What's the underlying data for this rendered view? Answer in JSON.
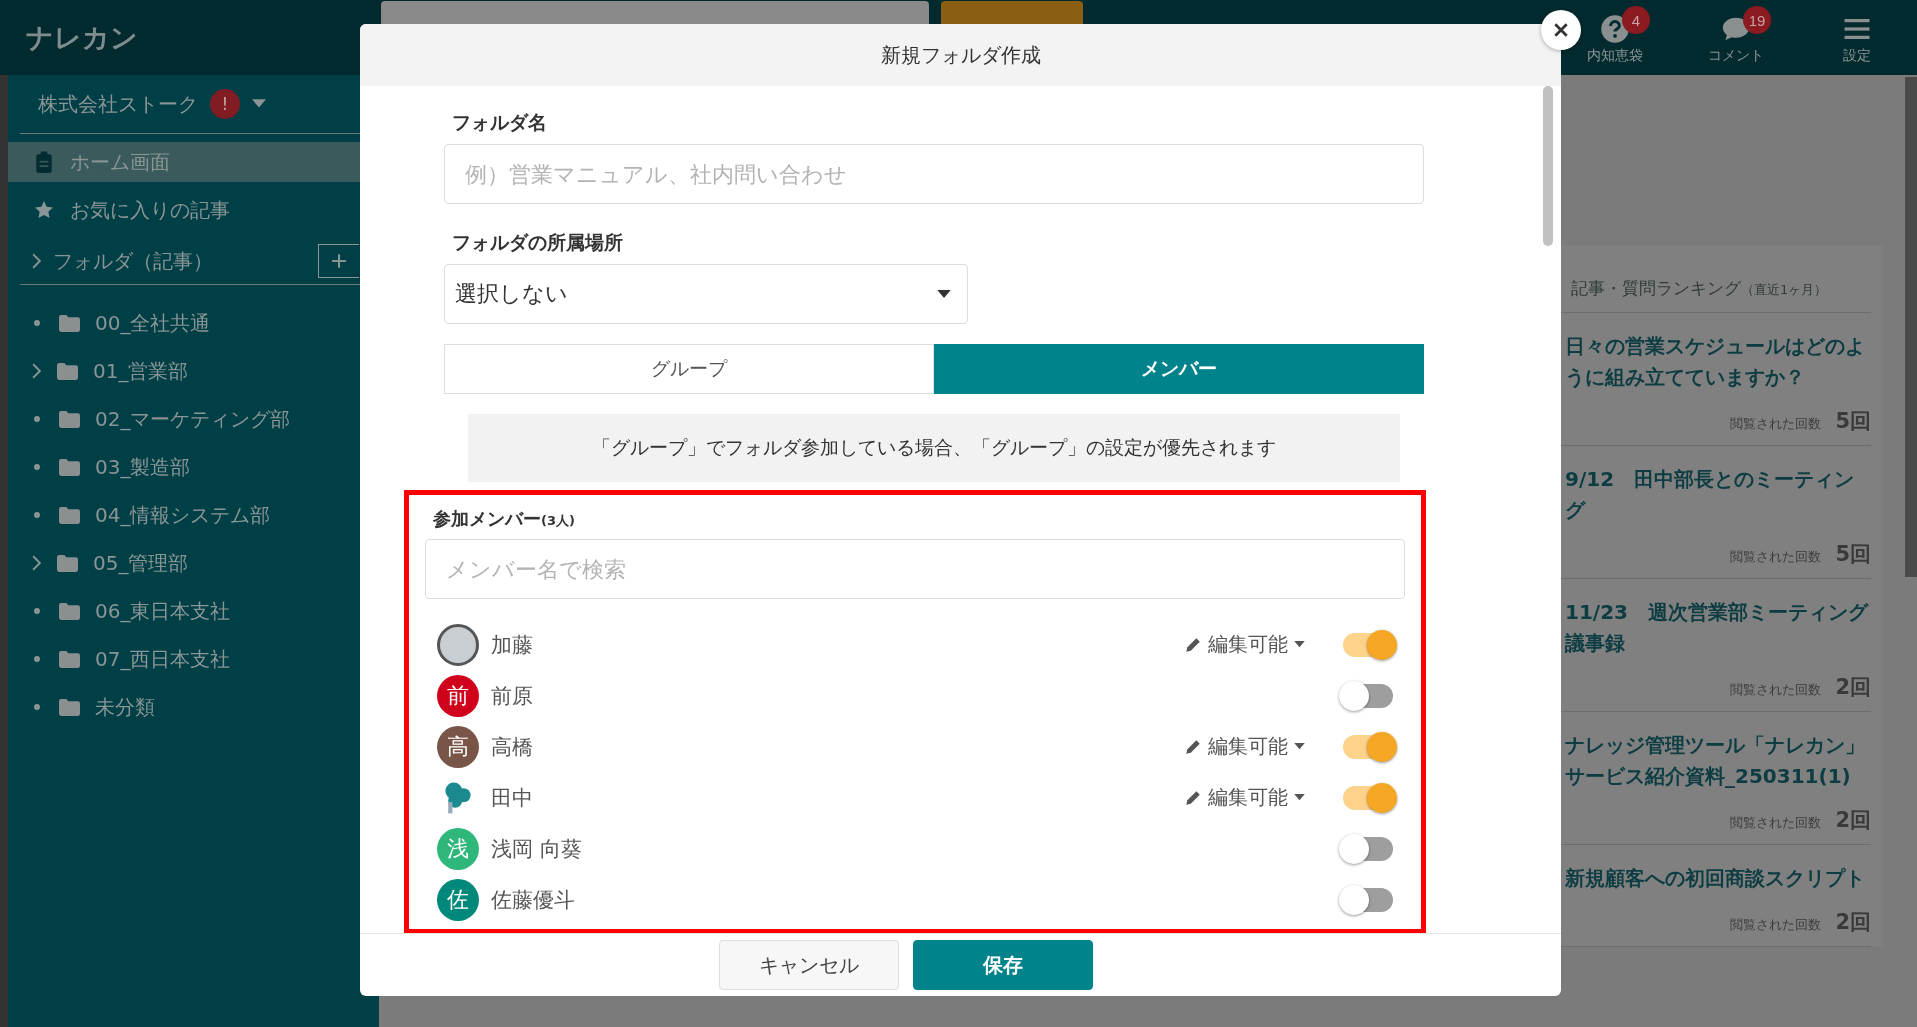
{
  "header": {
    "logo": "ナレカン",
    "icons": [
      {
        "kind": "help",
        "label": "内知恵袋",
        "badge": "4"
      },
      {
        "kind": "comment",
        "label": "コメント",
        "badge": "19"
      },
      {
        "kind": "menu",
        "label": "設定"
      }
    ]
  },
  "sidebar": {
    "company": "株式会社ストーク",
    "company_alert": "!",
    "nav": [
      {
        "kind": "home",
        "label": "ホーム画面",
        "selected": true
      },
      {
        "kind": "star",
        "label": "お気に入りの記事",
        "selected": false
      }
    ],
    "folder_section": {
      "label": "フォルダ（記事）"
    },
    "folders": [
      {
        "label": "00_全社共通",
        "expandable": false
      },
      {
        "label": "01_営業部",
        "expandable": true
      },
      {
        "label": "02_マーケティング部",
        "expandable": false
      },
      {
        "label": "03_製造部",
        "expandable": false
      },
      {
        "label": "04_情報システム部",
        "expandable": false
      },
      {
        "label": "05_管理部",
        "expandable": true
      },
      {
        "label": "06_東日本支社",
        "expandable": false
      },
      {
        "label": "07_西日本支社",
        "expandable": false
      },
      {
        "label": "未分類",
        "expandable": false
      }
    ]
  },
  "ranking": {
    "title": "記事・質問ランキング",
    "period": "（直近1ヶ月）",
    "items": [
      {
        "title": "日々の営業スケジュールはどのように組み立てていますか？",
        "views_label": "閲覧された回数",
        "views": "5回"
      },
      {
        "title": "9/12　田中部長とのミーティング",
        "views_label": "閲覧された回数",
        "views": "5回"
      },
      {
        "title": "11/23　週次営業部ミーティング議事録",
        "views_label": "閲覧された回数",
        "views": "2回"
      },
      {
        "title": "ナレッジ管理ツール「ナレカン」サービス紹介資料_250311(1)",
        "views_label": "閲覧された回数",
        "views": "2回"
      },
      {
        "title": "新規顧客への初回商談スクリプト",
        "views_label": "閲覧された回数",
        "views": "2回"
      }
    ]
  },
  "dialog": {
    "title": "新規フォルダ作成",
    "name_field": {
      "label": "フォルダ名",
      "placeholder": "例）営業マニュアル、社内問い合わせ"
    },
    "location_field": {
      "label": "フォルダの所属場所",
      "value": "選択しない"
    },
    "tabs": [
      {
        "label": "グループ",
        "selected": false
      },
      {
        "label": "メンバー",
        "selected": true
      }
    ],
    "notice": "「グループ」でフォルダ参加している場合、「グループ」の設定が優先されます",
    "members_label": "参加メンバー",
    "members_count": "(3人)",
    "member_search": {
      "placeholder": "メンバー名で検索"
    },
    "members": [
      {
        "name": "加藤",
        "kind": "image",
        "permission": "編集可能",
        "on": true
      },
      {
        "name": "前原",
        "kind": "initial",
        "initial": "前",
        "color": "#d0021b",
        "on": false
      },
      {
        "name": "高橋",
        "kind": "initial",
        "initial": "高",
        "color": "#795548",
        "permission": "編集可能",
        "on": true
      },
      {
        "name": "田中",
        "kind": "logo",
        "permission": "編集可能",
        "on": true
      },
      {
        "name": "浅岡 向葵",
        "kind": "initial",
        "initial": "浅",
        "color": "#2fb67a",
        "on": false
      },
      {
        "name": "佐藤優斗",
        "kind": "initial",
        "initial": "佐",
        "color": "#00897b",
        "on": false
      }
    ],
    "buttons": [
      {
        "kind": "secondary",
        "label": "キャンセル"
      },
      {
        "kind": "primary",
        "label": "保存"
      }
    ]
  }
}
